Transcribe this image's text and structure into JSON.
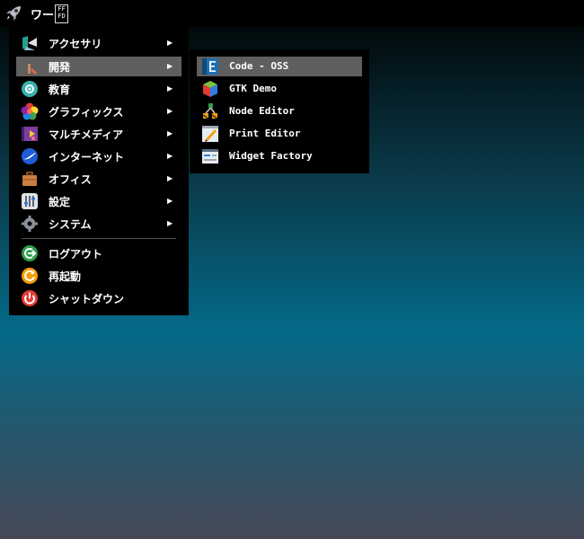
{
  "topbar": {
    "launcher_icon": "rocket-icon",
    "title": "ワー",
    "glyph_box": "FFFD"
  },
  "menu": {
    "items": [
      {
        "label": "アクセサリ",
        "icon": "accessories-icon",
        "submenu": true
      },
      {
        "label": "開発",
        "icon": "development-icon",
        "submenu": true,
        "selected": true
      },
      {
        "label": "教育",
        "icon": "education-icon",
        "submenu": true
      },
      {
        "label": "グラフィックス",
        "icon": "graphics-icon",
        "submenu": true
      },
      {
        "label": "マルチメディア",
        "icon": "multimedia-icon",
        "submenu": true
      },
      {
        "label": "インターネット",
        "icon": "internet-icon",
        "submenu": true
      },
      {
        "label": "オフィス",
        "icon": "office-icon",
        "submenu": true
      },
      {
        "label": "設定",
        "icon": "settings-icon",
        "submenu": true
      },
      {
        "label": "システム",
        "icon": "system-icon",
        "submenu": true
      }
    ],
    "actions": [
      {
        "label": "ログアウト",
        "icon": "logout-icon"
      },
      {
        "label": "再起動",
        "icon": "reboot-icon"
      },
      {
        "label": "シャットダウン",
        "icon": "shutdown-icon"
      }
    ],
    "arrow": "▶"
  },
  "submenu": {
    "items": [
      {
        "label": "Code - OSS",
        "icon": "code-oss-icon",
        "selected": true
      },
      {
        "label": "GTK Demo",
        "icon": "gtk-demo-icon"
      },
      {
        "label": "Node Editor",
        "icon": "node-editor-icon"
      },
      {
        "label": "Print Editor",
        "icon": "print-editor-icon"
      },
      {
        "label": "Widget Factory",
        "icon": "widget-factory-icon"
      }
    ]
  },
  "colors": {
    "menu_bg": "#000000",
    "highlight": "#5f5f5f"
  }
}
